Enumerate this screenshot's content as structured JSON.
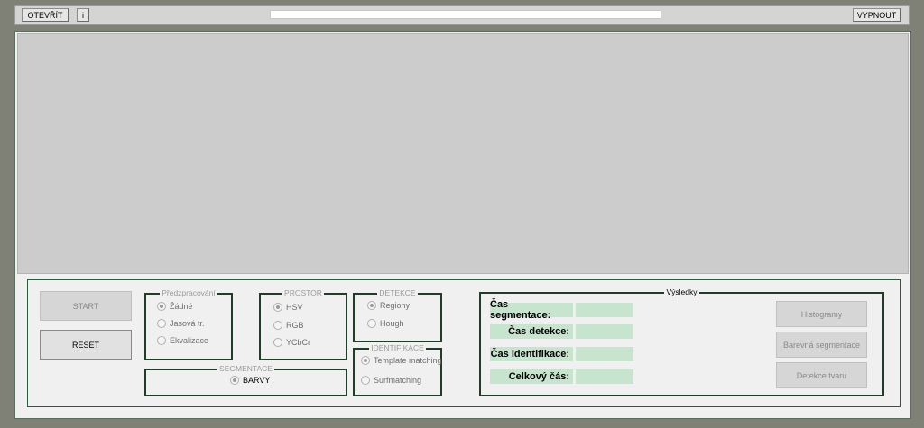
{
  "toolbar": {
    "open_label": "OTEVŘÍT",
    "info_label": "i",
    "close_label": "VYPNOUT",
    "progress": 0
  },
  "controls": {
    "start_label": "START",
    "reset_label": "RESET"
  },
  "preprocessing": {
    "title": "Předzpracování",
    "options": [
      "Žádné",
      "Jasová tr.",
      "Ekvalizace"
    ],
    "selected": "Žádné"
  },
  "space": {
    "title": "PROSTOR",
    "options": [
      "HSV",
      "RGB",
      "YCbCr"
    ],
    "selected": "HSV"
  },
  "detection": {
    "title": "DETEKCE",
    "options": [
      "Regiony",
      "Hough"
    ],
    "selected": "Regiony"
  },
  "identification": {
    "title": "IDENTIFIKACE",
    "options": [
      "Template matching",
      "Surfmatching"
    ],
    "selected": "Template matching"
  },
  "segmentation": {
    "title": "SEGMENTACE",
    "options": [
      "BARVY"
    ],
    "selected": "BARVY"
  },
  "results": {
    "title": "Výsledky",
    "rows": [
      {
        "label": "Čas segmentace:",
        "value": ""
      },
      {
        "label": "Čas detekce:",
        "value": ""
      },
      {
        "label": "Čas identifikace:",
        "value": ""
      },
      {
        "label": "Celkový čás:",
        "value": ""
      }
    ],
    "buttons": [
      "Histogramy",
      "Barevná segmentace",
      "Detekce tvaru"
    ]
  }
}
